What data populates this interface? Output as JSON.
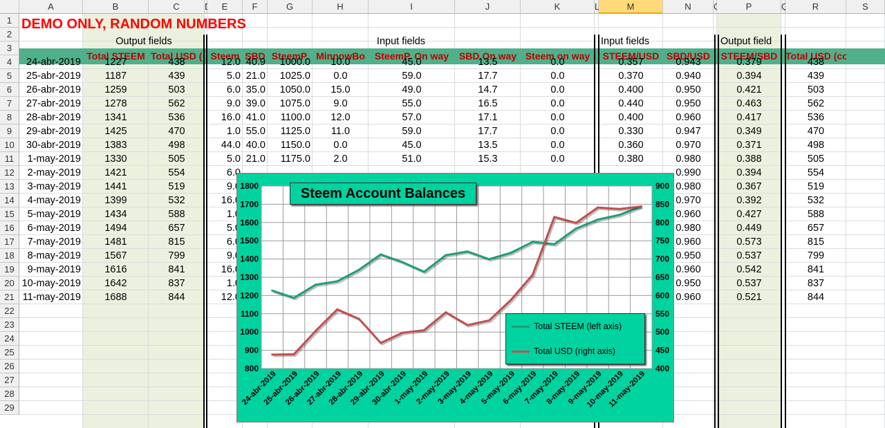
{
  "spreadsheet": {
    "columns": [
      "A",
      "B",
      "C",
      "D",
      "E",
      "F",
      "G",
      "H",
      "I",
      "J",
      "K",
      "L",
      "M",
      "N",
      "O",
      "P",
      "Q",
      "R",
      "S"
    ],
    "selected_column": "M",
    "row_numbers": [
      "1",
      "2",
      "3",
      "4",
      "5",
      "6",
      "7",
      "8",
      "9",
      "10",
      "11",
      "12",
      "13",
      "14",
      "15",
      "16",
      "17",
      "18",
      "19",
      "20",
      "21",
      "22",
      "23",
      "24",
      "25",
      "26",
      "27",
      "28",
      "29"
    ],
    "banner": "DEMO ONLY, RANDOM NUMBERS",
    "group_labels": {
      "output_fields": "Output fields",
      "input_fields": "Input fields",
      "input_fields_2": "Input fields",
      "output_field": "Output field"
    },
    "headers": {
      "b": "Total STEEM",
      "c": "Total USD (",
      "e": "Steem",
      "f": "SBD",
      "g": "SteemP.",
      "h": "MinnowBo",
      "i": "SteemP. On way",
      "j": "SBD On way",
      "k": "Steem on way",
      "m": "STEEM/USD",
      "n": "SBD/USD",
      "p": "STEEM/SBD",
      "r": "Total  USD (control)"
    },
    "rows": [
      {
        "a": "24-abr-2019",
        "b": "1227",
        "c": "438",
        "e": "12.0",
        "f": "40.9",
        "g": "1000.0",
        "h": "10.0",
        "i": "45.0",
        "j": "13.5",
        "k": "0.0",
        "m": "0.357",
        "n": "0.943",
        "p": "0.379",
        "r": "438"
      },
      {
        "a": "25-abr-2019",
        "b": "1187",
        "c": "439",
        "e": "5.0",
        "f": "21.0",
        "g": "1025.0",
        "h": "0.0",
        "i": "59.0",
        "j": "17.7",
        "k": "0.0",
        "m": "0.370",
        "n": "0.940",
        "p": "0.394",
        "r": "439"
      },
      {
        "a": "26-abr-2019",
        "b": "1259",
        "c": "503",
        "e": "6.0",
        "f": "35.0",
        "g": "1050.0",
        "h": "15.0",
        "i": "49.0",
        "j": "14.7",
        "k": "0.0",
        "m": "0.400",
        "n": "0.950",
        "p": "0.421",
        "r": "503"
      },
      {
        "a": "27-abr-2019",
        "b": "1278",
        "c": "562",
        "e": "9.0",
        "f": "39.0",
        "g": "1075.0",
        "h": "9.0",
        "i": "55.0",
        "j": "16.5",
        "k": "0.0",
        "m": "0.440",
        "n": "0.950",
        "p": "0.463",
        "r": "562"
      },
      {
        "a": "28-abr-2019",
        "b": "1341",
        "c": "536",
        "e": "16.0",
        "f": "41.0",
        "g": "1100.0",
        "h": "12.0",
        "i": "57.0",
        "j": "17.1",
        "k": "0.0",
        "m": "0.400",
        "n": "0.960",
        "p": "0.417",
        "r": "536"
      },
      {
        "a": "29-abr-2019",
        "b": "1425",
        "c": "470",
        "e": "1.0",
        "f": "55.0",
        "g": "1125.0",
        "h": "11.0",
        "i": "59.0",
        "j": "17.7",
        "k": "0.0",
        "m": "0.330",
        "n": "0.947",
        "p": "0.349",
        "r": "470"
      },
      {
        "a": "30-abr-2019",
        "b": "1383",
        "c": "498",
        "e": "44.0",
        "f": "40.0",
        "g": "1150.0",
        "h": "0.0",
        "i": "45.0",
        "j": "13.5",
        "k": "0.0",
        "m": "0.360",
        "n": "0.970",
        "p": "0.371",
        "r": "498"
      },
      {
        "a": "1-may-2019",
        "b": "1330",
        "c": "505",
        "e": "5.0",
        "f": "21.0",
        "g": "1175.0",
        "h": "2.0",
        "i": "51.0",
        "j": "15.3",
        "k": "0.0",
        "m": "0.380",
        "n": "0.980",
        "p": "0.388",
        "r": "505"
      },
      {
        "a": "2-may-2019",
        "b": "1421",
        "c": "554",
        "e": "6.0",
        "f": "",
        "g": "",
        "h": "",
        "i": "",
        "j": "",
        "k": "",
        "m": "",
        "n": "0.990",
        "p": "0.394",
        "r": "554"
      },
      {
        "a": "3-may-2019",
        "b": "1441",
        "c": "519",
        "e": "9.0",
        "f": "",
        "g": "",
        "h": "",
        "i": "",
        "j": "",
        "k": "",
        "m": "",
        "n": "0.980",
        "p": "0.367",
        "r": "519"
      },
      {
        "a": "4-may-2019",
        "b": "1399",
        "c": "532",
        "e": "16.0",
        "f": "",
        "g": "",
        "h": "",
        "i": "",
        "j": "",
        "k": "",
        "m": "",
        "n": "0.970",
        "p": "0.392",
        "r": "532"
      },
      {
        "a": "5-may-2019",
        "b": "1434",
        "c": "588",
        "e": "1.0",
        "f": "",
        "g": "",
        "h": "",
        "i": "",
        "j": "",
        "k": "",
        "m": "",
        "n": "0.960",
        "p": "0.427",
        "r": "588"
      },
      {
        "a": "6-may-2019",
        "b": "1494",
        "c": "657",
        "e": "5.0",
        "f": "",
        "g": "",
        "h": "",
        "i": "",
        "j": "",
        "k": "",
        "m": "",
        "n": "0.980",
        "p": "0.449",
        "r": "657"
      },
      {
        "a": "7-may-2019",
        "b": "1481",
        "c": "815",
        "e": "6.0",
        "f": "",
        "g": "",
        "h": "",
        "i": "",
        "j": "",
        "k": "",
        "m": "",
        "n": "0.960",
        "p": "0.573",
        "r": "815"
      },
      {
        "a": "8-may-2019",
        "b": "1567",
        "c": "799",
        "e": "9.0",
        "f": "",
        "g": "",
        "h": "",
        "i": "",
        "j": "",
        "k": "",
        "m": "",
        "n": "0.950",
        "p": "0.537",
        "r": "799"
      },
      {
        "a": "9-may-2019",
        "b": "1616",
        "c": "841",
        "e": "16.0",
        "f": "",
        "g": "",
        "h": "",
        "i": "",
        "j": "",
        "k": "",
        "m": "",
        "n": "0.960",
        "p": "0.542",
        "r": "841"
      },
      {
        "a": "10-may-2019",
        "b": "1642",
        "c": "837",
        "e": "1.0",
        "f": "",
        "g": "",
        "h": "",
        "i": "",
        "j": "",
        "k": "",
        "m": "",
        "n": "0.950",
        "p": "0.537",
        "r": "837"
      },
      {
        "a": "11-may-2019",
        "b": "1688",
        "c": "844",
        "e": "12.0",
        "f": "",
        "g": "",
        "h": "",
        "i": "",
        "j": "",
        "k": "",
        "m": "",
        "n": "0.960",
        "p": "0.521",
        "r": "844"
      }
    ],
    "colors": {
      "banner_red": "#ff0000",
      "header_red": "#c00000",
      "header_band": "#4fb08a",
      "output_fill": "#ebf1de",
      "selected_header": "#ffd97a"
    }
  },
  "chart_data": {
    "type": "line",
    "title": "Steem Account Balances",
    "categories": [
      "24-abr-2019",
      "25-abr-2019",
      "26-abr-2019",
      "27-abr-2019",
      "28-abr-2019",
      "29-abr-2019",
      "30-abr-2019",
      "1-may-2019",
      "2-may-2019",
      "3-may-2019",
      "4-may-2019",
      "5-may-2019",
      "6-may-2019",
      "7-may-2019",
      "8-may-2019",
      "9-may-2019",
      "10-may-2019",
      "11-may-2019"
    ],
    "series": [
      {
        "name": "Total STEEM (left axis)",
        "axis": "left",
        "color": "#1e9e78",
        "values": [
          1227,
          1187,
          1259,
          1278,
          1341,
          1425,
          1383,
          1330,
          1421,
          1441,
          1399,
          1434,
          1494,
          1481,
          1567,
          1616,
          1642,
          1688
        ]
      },
      {
        "name": "Total USD (right axis)",
        "axis": "right",
        "color": "#c0504d",
        "values": [
          438,
          439,
          503,
          562,
          536,
          470,
          498,
          505,
          554,
          519,
          532,
          588,
          657,
          815,
          799,
          841,
          837,
          844
        ]
      }
    ],
    "left_ylim": [
      800,
      1800
    ],
    "left_ticks": [
      "800",
      "900",
      "1000",
      "1100",
      "1200",
      "1300",
      "1400",
      "1500",
      "1600",
      "1700",
      "1800"
    ],
    "right_ylim": [
      400,
      900
    ],
    "right_ticks": [
      "400",
      "450",
      "500",
      "550",
      "600",
      "650",
      "700",
      "750",
      "800",
      "850",
      "900"
    ],
    "grid": true,
    "legend_position": "bottom-right",
    "background": "#00d2a0"
  }
}
